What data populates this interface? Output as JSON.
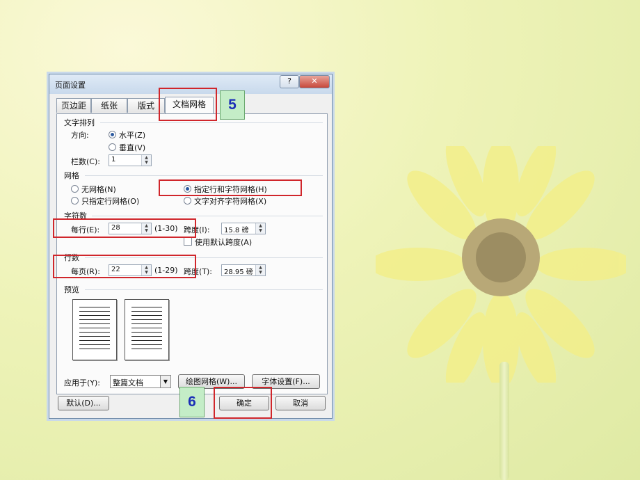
{
  "dialog": {
    "title": "页面设置",
    "help_label": "?",
    "close_label": "✕",
    "tabs": [
      {
        "label": "页边距"
      },
      {
        "label": "纸张"
      },
      {
        "label": "版式"
      },
      {
        "label": "文档网格"
      }
    ],
    "text_direction": {
      "header": "文字排列",
      "direction_label": "方向:",
      "horizontal": "水平(Z)",
      "vertical": "垂直(V)",
      "columns_label": "栏数(C):",
      "columns_value": "1"
    },
    "grid": {
      "header": "网格",
      "no_grid": "无网格(N)",
      "lines_only": "只指定行网格(O)",
      "lines_and_chars": "指定行和字符网格(H)",
      "snap_chars": "文字对齐字符网格(X)"
    },
    "characters": {
      "header": "字符数",
      "per_line_label": "每行(E):",
      "per_line_value": "28",
      "per_line_range": "(1-30)",
      "pitch_label": "跨度(I):",
      "pitch_value": "15.8 磅",
      "default_pitch": "使用默认跨度(A)"
    },
    "lines": {
      "header": "行数",
      "per_page_label": "每页(R):",
      "per_page_value": "22",
      "per_page_range": "(1-29)",
      "pitch_label": "跨度(T):",
      "pitch_value": "28.95 磅"
    },
    "preview_header": "预览",
    "apply_to_label": "应用于(Y):",
    "apply_to_value": "整篇文档",
    "drawing_grid_button": "绘图网格(W)...",
    "font_settings_button": "字体设置(F)...",
    "default_button": "默认(D)...",
    "ok_button": "确定",
    "cancel_button": "取消"
  },
  "annotations": {
    "step5": "5",
    "step6": "6"
  },
  "colors": {
    "highlight_red": "#d0262b",
    "badge_green": "#c4edc7",
    "badge_text": "#1b2fb7"
  }
}
